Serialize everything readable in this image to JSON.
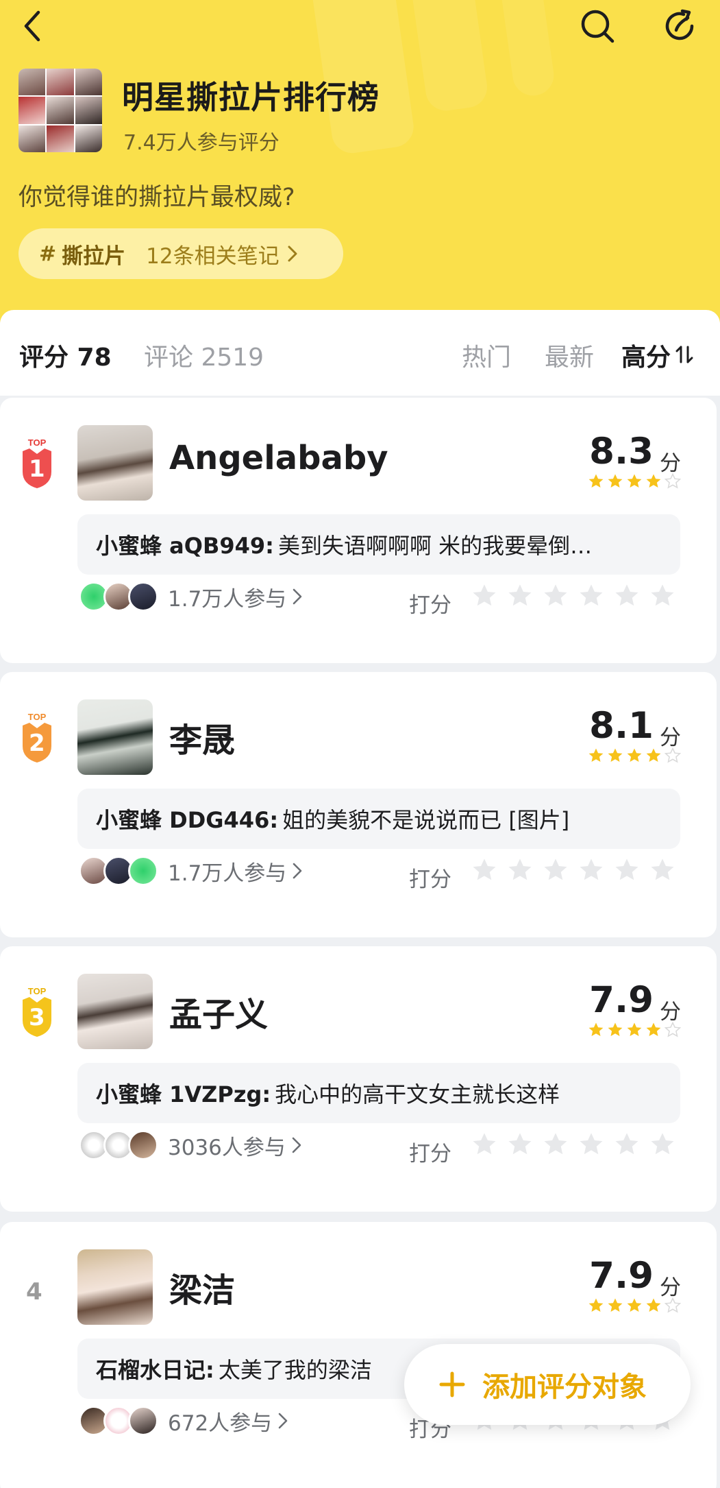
{
  "header": {
    "title": "明星撕拉片排行榜",
    "participants": "7.4万人参与评分",
    "question": "你觉得谁的撕拉片最权威?",
    "topic": {
      "hash": "#",
      "tag": "撕拉片",
      "notes": "12条相关笔记"
    }
  },
  "tabs": {
    "rating": "评分 78",
    "comments": "评论 2519",
    "sort_hot": "热门",
    "sort_new": "最新",
    "sort_high": "高分"
  },
  "colors": {
    "accent": "#fae04b",
    "star": "#f7c21a",
    "fab_text": "#e8a800"
  },
  "items": [
    {
      "rank": "1",
      "name": "Angelababy",
      "score": "8.3",
      "unit": "分",
      "stars": 4,
      "comment_author": "小蜜蜂 aQB949:",
      "comment_text": "美到失语啊啊啊 米的我要晕倒…",
      "participants": "1.7万人参与",
      "rate_label": "打分"
    },
    {
      "rank": "2",
      "name": "李晟",
      "score": "8.1",
      "unit": "分",
      "stars": 4,
      "comment_author": "小蜜蜂 DDG446:",
      "comment_text": "姐的美貌不是说说而已 [图片]",
      "participants": "1.7万人参与",
      "rate_label": "打分"
    },
    {
      "rank": "3",
      "name": "孟子义",
      "score": "7.9",
      "unit": "分",
      "stars": 4,
      "comment_author": "小蜜蜂 1VZPzg:",
      "comment_text": "我心中的高干文女主就长这样",
      "participants": "3036人参与",
      "rate_label": "打分"
    },
    {
      "rank": "4",
      "name": "梁洁",
      "score": "7.9",
      "unit": "分",
      "stars": 4,
      "comment_author": "石榴水日记:",
      "comment_text": "太美了我的梁洁",
      "participants": "672人参与",
      "rate_label": "打分"
    }
  ],
  "fab": {
    "label": "添加评分对象"
  }
}
